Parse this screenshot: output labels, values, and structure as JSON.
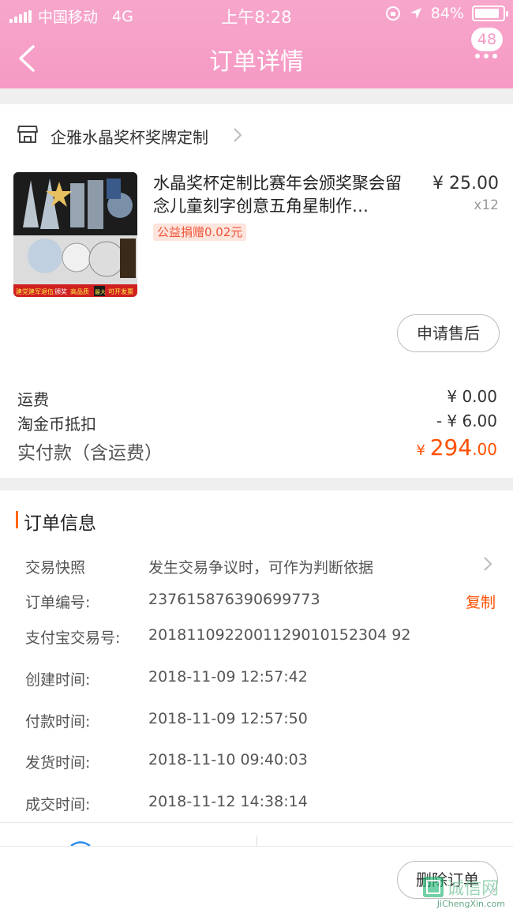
{
  "status_bar": {
    "carrier": "中国移动",
    "network": "4G",
    "time": "上午8:28",
    "battery": "84%"
  },
  "nav": {
    "title": "订单详情",
    "badge": "48"
  },
  "shop": {
    "name": "企雅水晶奖杯奖牌定制"
  },
  "item": {
    "title": "水晶奖杯定制比赛年会颁奖聚会留念儿童刻字创意五角星制作…",
    "price": "¥ 25.00",
    "qty": "x12",
    "charity": "公益捐赠0.02元",
    "thumb_banner": [
      "建党建军退伍",
      "颁奖",
      "高品质",
      "最大",
      "可开发票"
    ],
    "aftersale_label": "申请售后"
  },
  "fees": [
    {
      "label": "运费",
      "value": "¥ 0.00"
    },
    {
      "label": "淘金币抵扣",
      "value": "- ¥ 6.00"
    }
  ],
  "total": {
    "label": "实付款（含运费）",
    "yen": "¥ ",
    "int": "294",
    "dec": ".00"
  },
  "order_info": {
    "title": "订单信息",
    "snapshot": {
      "label": "交易快照",
      "value": "发生交易争议时，可作为判断依据"
    },
    "order_no": {
      "label": "订单编号:",
      "value": "237615876390699773",
      "copy": "复制"
    },
    "alipay_no": {
      "label": "支付宝交易号:",
      "value": "2018110922001129010152304 92"
    },
    "created": {
      "label": "创建时间:",
      "value": "2018-11-09 12:57:42"
    },
    "paid": {
      "label": "付款时间:",
      "value": "2018-11-09 12:57:50"
    },
    "shipped": {
      "label": "发货时间:",
      "value": "2018-11-10 09:40:03"
    },
    "completed": {
      "label": "成交时间:",
      "value": "2018-11-12 14:38:14"
    }
  },
  "bottom": {
    "delete_label": "删除订单",
    "watermark": "诚信网",
    "watermark_url": "JiChengXin.com"
  },
  "colors": {
    "header": "#f59ac4",
    "accent": "#ff5000",
    "section_bar": "#ff6a00"
  }
}
